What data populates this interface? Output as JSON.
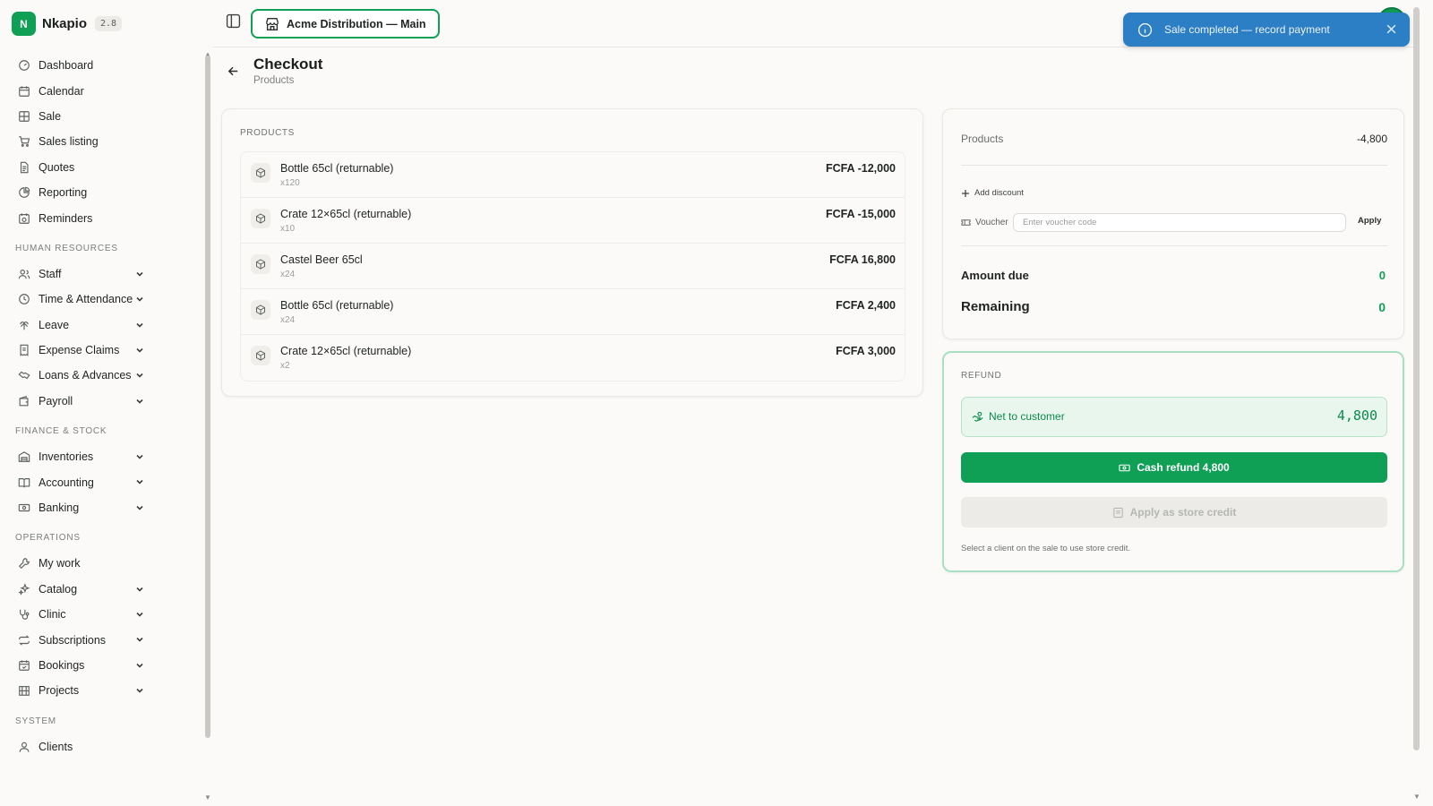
{
  "app": {
    "logo_letter": "N",
    "name": "Nkapio",
    "version": "2.8"
  },
  "branch": {
    "label": "Acme Distribution — Main"
  },
  "toast": {
    "message": "Sale completed — record payment"
  },
  "page": {
    "title": "Checkout",
    "subtitle": "Products"
  },
  "sidebar": {
    "main_items": [
      {
        "label": "Dashboard",
        "icon": "dashboard-icon"
      },
      {
        "label": "Calendar",
        "icon": "calendar-icon"
      },
      {
        "label": "Sale",
        "icon": "grid-icon"
      },
      {
        "label": "Sales listing",
        "icon": "cart-icon"
      },
      {
        "label": "Quotes",
        "icon": "document-icon"
      },
      {
        "label": "Reporting",
        "icon": "pie-chart-icon"
      },
      {
        "label": "Reminders",
        "icon": "alarm-calendar-icon"
      }
    ],
    "hr_section": "HUMAN RESOURCES",
    "hr_items": [
      {
        "label": "Staff",
        "icon": "users-icon"
      },
      {
        "label": "Time & Attendance",
        "icon": "clock-icon"
      },
      {
        "label": "Leave",
        "icon": "palm-icon"
      },
      {
        "label": "Expense Claims",
        "icon": "receipt-icon"
      },
      {
        "label": "Loans & Advances",
        "icon": "handshake-icon"
      },
      {
        "label": "Payroll",
        "icon": "wallet-icon"
      }
    ],
    "finance_section": "FINANCE & STOCK",
    "finance_items": [
      {
        "label": "Inventories",
        "icon": "warehouse-icon"
      },
      {
        "label": "Accounting",
        "icon": "book-icon"
      },
      {
        "label": "Banking",
        "icon": "banknote-icon"
      }
    ],
    "ops_section": "OPERATIONS",
    "ops_items": [
      {
        "label": "My work",
        "icon": "wrench-icon"
      },
      {
        "label": "Catalog",
        "icon": "sparkle-icon"
      },
      {
        "label": "Clinic",
        "icon": "stethoscope-icon"
      },
      {
        "label": "Subscriptions",
        "icon": "repeat-icon"
      },
      {
        "label": "Bookings",
        "icon": "calendar-check-icon"
      },
      {
        "label": "Projects",
        "icon": "building-icon"
      }
    ],
    "system_section": "SYSTEM",
    "system_items": [
      {
        "label": "Clients",
        "icon": "user-icon"
      }
    ]
  },
  "products": {
    "section_label": "PRODUCTS",
    "items": [
      {
        "name": "Bottle 65cl (returnable)",
        "qty": "x120",
        "amount": "FCFA -12,000"
      },
      {
        "name": "Crate 12×65cl (returnable)",
        "qty": "x10",
        "amount": "FCFA -15,000"
      },
      {
        "name": "Castel Beer 65cl",
        "qty": "x24",
        "amount": "FCFA 16,800"
      },
      {
        "name": "Bottle 65cl (returnable)",
        "qty": "x24",
        "amount": "FCFA 2,400"
      },
      {
        "name": "Crate 12×65cl (returnable)",
        "qty": "x2",
        "amount": "FCFA 3,000"
      }
    ]
  },
  "summary": {
    "products_label": "Products",
    "products_value": "-4,800",
    "add_discount": "Add discount",
    "voucher_label": "Voucher",
    "voucher_placeholder": "Enter voucher code",
    "apply_label": "Apply",
    "amount_due_label": "Amount due",
    "amount_due_value": "0",
    "remaining_label": "Remaining",
    "remaining_value": "0"
  },
  "refund": {
    "section_label": "REFUND",
    "net_label": "Net to customer",
    "net_value": "4,800",
    "cash_button": "Cash refund 4,800",
    "store_credit_button": "Apply as store credit",
    "hint": "Select a client on the sale to use store credit."
  },
  "colors": {
    "accent": "#0f9f55",
    "toast": "#2c7fc4",
    "background": "#fbfaf8"
  }
}
